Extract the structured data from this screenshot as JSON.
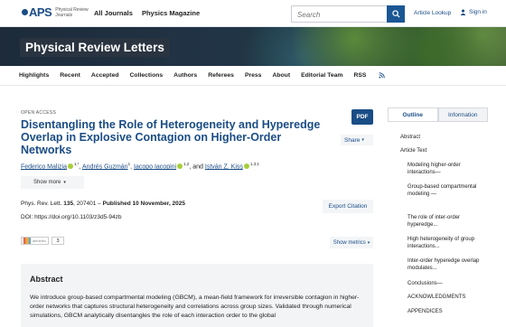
{
  "header": {
    "logo_text": "APS",
    "logo_sub": "Physical Review Journals",
    "nav": [
      "All Journals",
      "Physics Magazine"
    ],
    "search_placeholder": "Search",
    "article_lookup": "Article Lookup",
    "sign_in": "Sign in"
  },
  "banner": {
    "journal_title": "Physical Review Letters"
  },
  "main_nav": [
    "Highlights",
    "Recent",
    "Accepted",
    "Collections",
    "Authors",
    "Referees",
    "Press",
    "About",
    "Editorial Team",
    "RSS"
  ],
  "article": {
    "access": "OPEN ACCESS",
    "title": "Disentangling the Role of Heterogeneity and Hyperedge Overlap in Explosive Contagion on Higher-Order Networks",
    "pdf_label": "PDF",
    "share_label": "Share",
    "authors": [
      {
        "name": "Federico Malizia",
        "sup": "1,*"
      },
      {
        "name": "Andrés Guzmán",
        "sup": "1"
      },
      {
        "name": "Iacopo Iacopini",
        "sup": "1,2"
      },
      {
        "name": "István Z. Kiss",
        "sup": "1,3,1"
      }
    ],
    "author_sep": ", ",
    "author_and": ", and ",
    "show_more": "Show more",
    "citation_journal": "Phys. Rev. Lett.",
    "citation_volume": "135",
    "citation_rest": ", 207401 – ",
    "citation_published": "Published 10 November, 2025",
    "doi": "DOI: https://doi.org/10.1103/z3d5-94zb",
    "export_label": "Export Citation",
    "altmetric_text": "altmetric",
    "citations_count": "3",
    "show_metrics": "Show metrics"
  },
  "abstract": {
    "heading": "Abstract",
    "text": "We introduce group-based compartmental modeling (GBCM), a mean-field framework for irreversible contagion in higher-order networks that captures structural heterogeneity and correlations across group sizes. Validated through numerical simulations, GBCM analytically disentangles the role of each interaction order to the global"
  },
  "sidebar": {
    "tabs": [
      "Outline",
      "Information"
    ],
    "toc": [
      {
        "label": "Abstract",
        "level": 1
      },
      {
        "label": "Article Text",
        "level": 1
      },
      {
        "label": "Modeling higher-order interactions—",
        "level": 2
      },
      {
        "label": "Group-based compartmental modeling —",
        "level": 2
      },
      {
        "label": "The role of inter-order hyperedge...",
        "level": 2
      },
      {
        "label": "High heterogeneity of group interactions...",
        "level": 2
      },
      {
        "label": "Inter-order hyperedge overlap modulates...",
        "level": 2
      },
      {
        "label": "Conclusions—",
        "level": 2
      },
      {
        "label": "ACKNOWLEDGMENTS",
        "level": 2
      },
      {
        "label": "APPENDICES",
        "level": 2
      }
    ]
  },
  "colors": {
    "brand": "#1a4d86",
    "orcid": "#a6ce39"
  }
}
